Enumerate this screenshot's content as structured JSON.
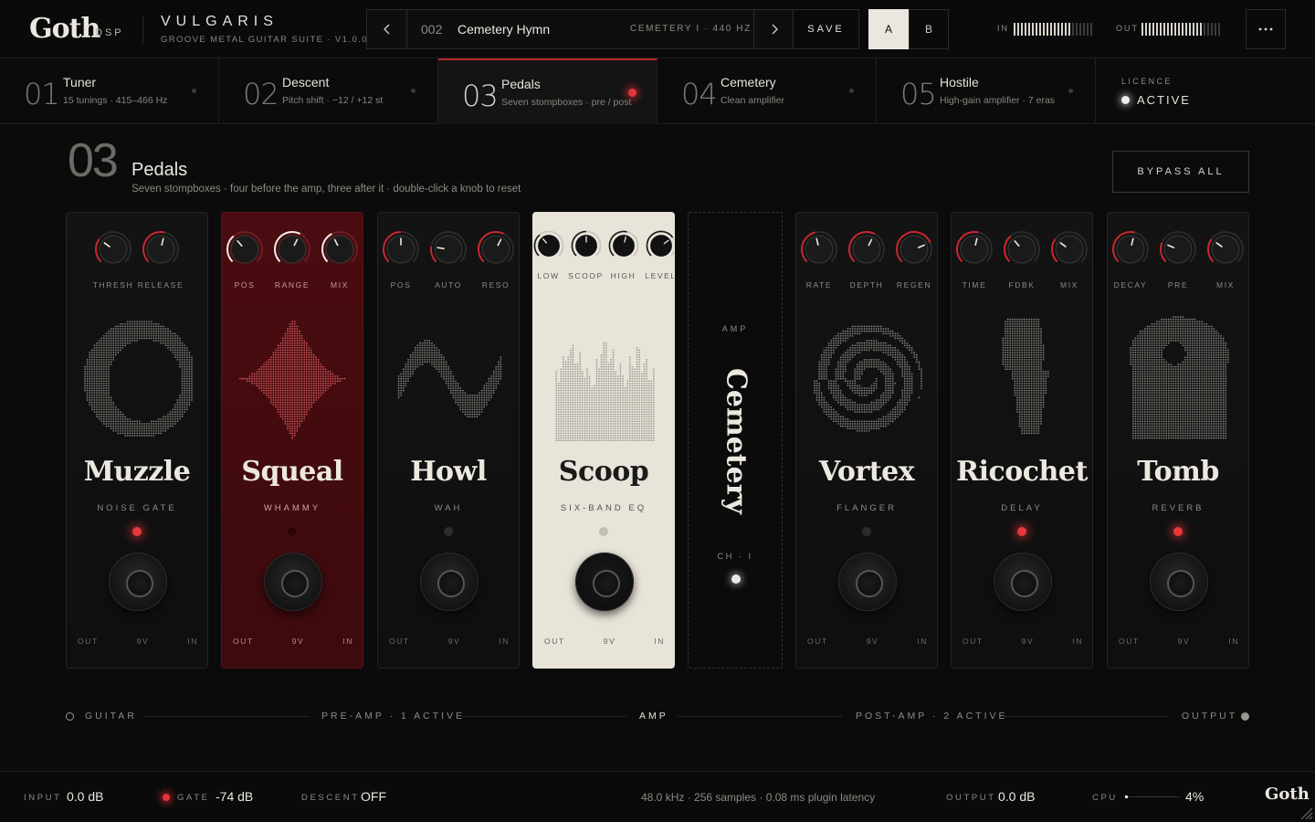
{
  "header": {
    "logo": "Goth",
    "logo_sub": "DSP",
    "product_name": "VULGARIS",
    "product_sub": "GROOVE METAL GUITAR SUITE · V1.0.0",
    "preset_number": "002",
    "preset_name": "Cemetery Hymn",
    "preset_info": "CEMETERY I · 440 HZ",
    "prev_icon": "chevron-left-icon",
    "next_icon": "chevron-right-icon",
    "save_label": "SAVE",
    "slot_a": "A",
    "slot_b": "B",
    "in_label": "IN",
    "out_label": "OUT",
    "in_level": 0.72,
    "out_level": 0.78,
    "menu_icon": "more-horizontal-icon"
  },
  "tabs": [
    {
      "num": "01",
      "title": "Tuner",
      "sub": "15 tunings · 415–466 Hz",
      "active": false
    },
    {
      "num": "02",
      "title": "Descent",
      "sub": "Pitch shift · −12 / +12 st",
      "active": false
    },
    {
      "num": "03",
      "title": "Pedals",
      "sub": "Seven stompboxes · pre / post",
      "active": true
    },
    {
      "num": "04",
      "title": "Cemetery",
      "sub": "Clean amplifier",
      "active": false
    },
    {
      "num": "05",
      "title": "Hostile",
      "sub": "High-gain amplifier · 7 eras",
      "active": false
    }
  ],
  "licence": {
    "label": "LICENCE",
    "state": "ACTIVE"
  },
  "section": {
    "num": "03",
    "title": "Pedals",
    "sub": "Seven stompboxes · four before the amp, three after it · double-click a knob to reset",
    "bypass_label": "BYPASS ALL"
  },
  "pedals": [
    {
      "name": "Muzzle",
      "type": "NOISE GATE",
      "theme": "dark",
      "led_on": true,
      "knobs": [
        {
          "label": "THRESH",
          "value": 0.3
        },
        {
          "label": "RELEASE",
          "value": 0.55
        }
      ],
      "jacks": [
        "OUT",
        "9V",
        "IN"
      ]
    },
    {
      "name": "Squeal",
      "type": "WHAMMY",
      "theme": "red",
      "led_on": false,
      "knobs": [
        {
          "label": "POS",
          "value": 0.35
        },
        {
          "label": "RANGE",
          "value": 0.6
        },
        {
          "label": "MIX",
          "value": 0.4
        }
      ],
      "jacks": [
        "OUT",
        "9V",
        "IN"
      ]
    },
    {
      "name": "Howl",
      "type": "WAH",
      "theme": "dark",
      "led_on": false,
      "knobs": [
        {
          "label": "POS",
          "value": 0.5
        },
        {
          "label": "AUTO",
          "value": 0.2
        },
        {
          "label": "RESO",
          "value": 0.6
        }
      ],
      "jacks": [
        "OUT",
        "9V",
        "IN"
      ]
    },
    {
      "name": "Scoop",
      "type": "SIX-BAND EQ",
      "theme": "cream",
      "led_on": false,
      "knobs": [
        {
          "label": "LOW",
          "value": 0.35
        },
        {
          "label": "SCOOP",
          "value": 0.5
        },
        {
          "label": "HIGH",
          "value": 0.55
        },
        {
          "label": "LEVEL",
          "value": 0.7
        }
      ],
      "jacks": [
        "OUT",
        "9V",
        "IN"
      ]
    },
    {
      "name": "Vortex",
      "type": "FLANGER",
      "theme": "dark",
      "led_on": false,
      "knobs": [
        {
          "label": "RATE",
          "value": 0.45
        },
        {
          "label": "DEPTH",
          "value": 0.6
        },
        {
          "label": "REGEN",
          "value": 0.75
        }
      ],
      "jacks": [
        "OUT",
        "9V",
        "IN"
      ]
    },
    {
      "name": "Ricochet",
      "type": "DELAY",
      "theme": "dark",
      "led_on": true,
      "knobs": [
        {
          "label": "TIME",
          "value": 0.55
        },
        {
          "label": "FDBK",
          "value": 0.35
        },
        {
          "label": "MIX",
          "value": 0.3
        }
      ],
      "jacks": [
        "OUT",
        "9V",
        "IN"
      ]
    },
    {
      "name": "Tomb",
      "type": "REVERB",
      "theme": "dark",
      "led_on": true,
      "knobs": [
        {
          "label": "DECAY",
          "value": 0.55
        },
        {
          "label": "PRE",
          "value": 0.25
        },
        {
          "label": "MIX",
          "value": 0.3
        }
      ],
      "jacks": [
        "OUT",
        "9V",
        "IN"
      ]
    }
  ],
  "amp_slot": {
    "label": "AMP",
    "name": "Cemetery",
    "channel": "CH · I"
  },
  "chain": {
    "guitar": "GUITAR",
    "pre_amp": "PRE-AMP · 1 ACTIVE",
    "amp": "AMP",
    "post_amp": "POST-AMP · 2 ACTIVE",
    "output": "OUTPUT"
  },
  "footer": {
    "input_label": "INPUT",
    "input_value": "0.0 dB",
    "gate_label": "GATE",
    "gate_value": "-74 dB",
    "descent_label": "DESCENT",
    "descent_value": "OFF",
    "engine_info": "48.0 kHz · 256 samples · 0.08 ms plugin latency",
    "output_label": "OUTPUT",
    "output_value": "0.0 dB",
    "cpu_label": "CPU",
    "cpu_value": "4%",
    "cpu_level": 0.04,
    "logo": "Goth"
  },
  "colors": {
    "accent": "#b3262a",
    "led_red": "#e8383e",
    "cream": "#e9e4d9",
    "bg": "#0b0b0b"
  }
}
